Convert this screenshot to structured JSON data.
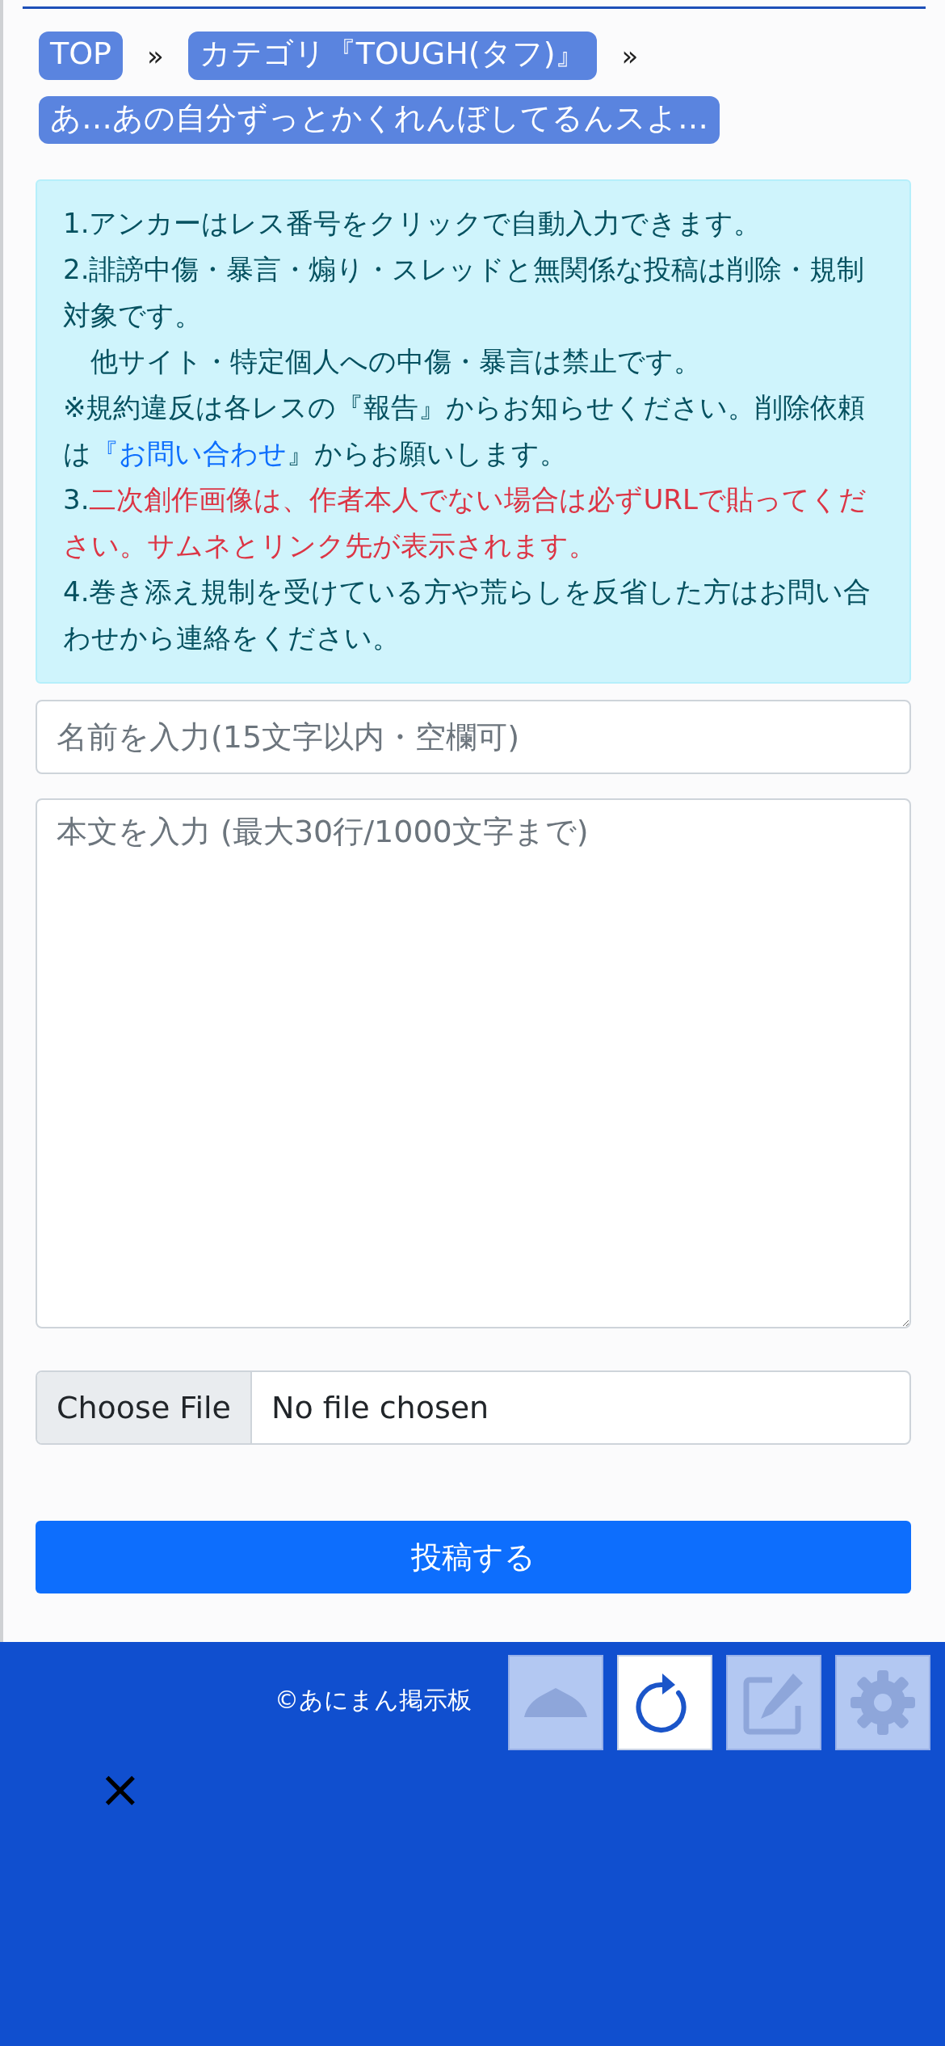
{
  "breadcrumbs": [
    {
      "label": "TOP",
      "separator": "»"
    },
    {
      "label": "カテゴリ『TOUGH(タフ)』",
      "separator": "»"
    },
    {
      "label": "あ…あの自分ずっとかくれんぼしてるんスよ…"
    }
  ],
  "notice": [
    {
      "kind": "plain",
      "text": "1.アンカーはレス番号をクリックで自動入力できます。"
    },
    {
      "kind": "plain",
      "text": "2.誹謗中傷・暴言・煽り・スレッドと無関係な投稿は削除・規制対象です。"
    },
    {
      "kind": "indent",
      "text": "他サイト・特定個人への中傷・暴言は禁止です。"
    },
    {
      "kind": "link",
      "before": "※規約違反は各レスの『報告』からお知らせください。削除依頼は",
      "link": "『お問い合わせ",
      "after": "』からお願いします。"
    },
    {
      "kind": "warning",
      "prefix": "3.",
      "text": "二次創作画像は、作者本人でない場合は必ずURLで貼ってください。サムネとリンク先が表示されます。"
    },
    {
      "kind": "plain",
      "text": "4.巻き添え規制を受けている方や荒らしを反省した方はお問い合わせから連絡をください。"
    }
  ],
  "form": {
    "name": {
      "placeholder": "名前を入力(15文字以内・空欄可)"
    },
    "body": {
      "placeholder": "本文を入力 (最大30行/1000文字まで)"
    },
    "file": {
      "button": "Choose File",
      "status": "No file chosen"
    },
    "submit": "投稿する"
  },
  "footer": {
    "copyright": "©あにまん掲示板",
    "close": "×"
  },
  "floating_buttons": [
    {
      "kind": "up",
      "active": false
    },
    {
      "kind": "reload",
      "active": true
    },
    {
      "kind": "edit",
      "active": false
    },
    {
      "kind": "settings",
      "active": false
    }
  ]
}
